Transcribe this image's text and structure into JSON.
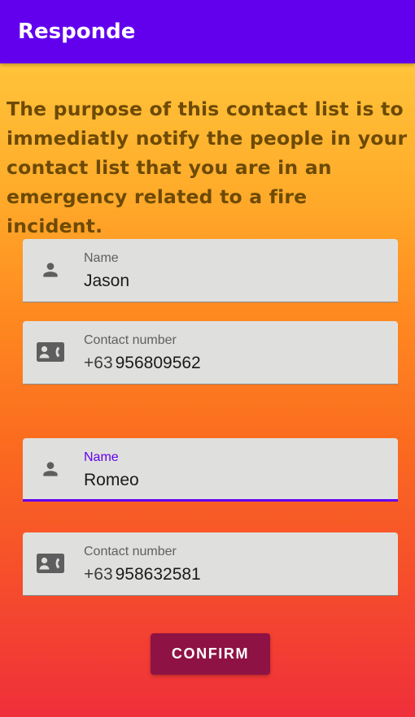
{
  "app_bar": {
    "title": "Responde"
  },
  "intro_text": "The purpose of this contact list is to immediatly notify the people in your contact list that you are in an emergency related to a fire incident.",
  "contacts": [
    {
      "name_label": "Name",
      "name_value": "Jason",
      "number_label": "Contact number",
      "number_prefix": "+63",
      "number_value": "956809562"
    },
    {
      "name_label": "Name",
      "name_value": "Romeo",
      "number_label": "Contact number",
      "number_prefix": "+63",
      "number_value": "958632581"
    }
  ],
  "confirm_label": "CONFIRM",
  "colors": {
    "app_bar": "#6200ee",
    "focus_accent": "#6200ee",
    "confirm_button": "#8e1244",
    "intro_text": "#6d4a05",
    "gradient_top": "#ffc33a",
    "gradient_bottom": "#ef2f3a"
  },
  "icons": {
    "name_field": "person-icon",
    "number_field": "contact-card-icon"
  }
}
